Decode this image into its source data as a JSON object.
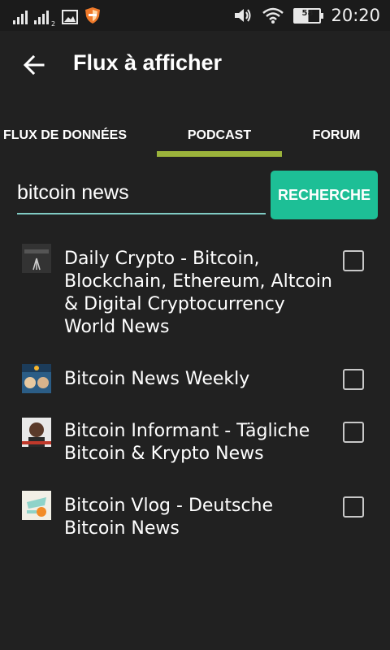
{
  "status_bar": {
    "time": "20:20",
    "battery": "58",
    "sim_sub": "2",
    "icons": [
      "signal-icon",
      "signal-icon",
      "image-icon",
      "shield-icon",
      "volume-icon",
      "wifi-icon",
      "battery-icon"
    ]
  },
  "appbar": {
    "title": "Flux à afficher",
    "back_icon": "arrow-left-icon"
  },
  "tabs": [
    {
      "label": "FLUX DE DONNÉES",
      "selected": false
    },
    {
      "label": "PODCAST",
      "selected": true
    },
    {
      "label": "FORUM",
      "selected": false
    }
  ],
  "colors": {
    "background": "#212121",
    "tab_indicator": "#9bb33b",
    "button": "#1dbf96",
    "input_underline": "#80cbc4"
  },
  "search": {
    "value": "bitcoin news",
    "button_label": "RECHERCHE"
  },
  "results": [
    {
      "label": "Daily Crypto - Bitcoin, Blockchain, Ethereum, Altcoin & Digital Cryptocurrency World News",
      "checked": false,
      "thumb_text": "DAILYCRYPTO"
    },
    {
      "label": "Bitcoin News Weekly",
      "checked": false,
      "thumb_text": "₿"
    },
    {
      "label": "Bitcoin Informant - Tägliche Bitcoin & Krypto News",
      "checked": false
    },
    {
      "label": "Bitcoin Vlog - Deutsche Bitcoin News",
      "checked": false
    }
  ]
}
